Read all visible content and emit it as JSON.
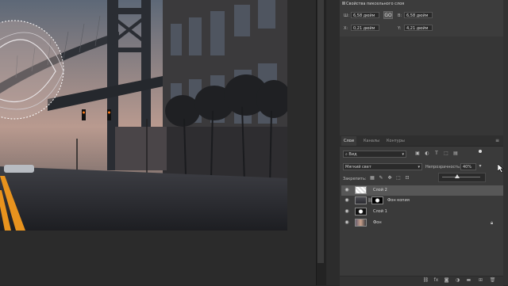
{
  "properties": {
    "title": "Свойства пиксельного слоя",
    "width_label": "Ш:",
    "width_value": "6,58 дюйм",
    "link_symbol": "GO",
    "height_label": "В:",
    "height_value": "6,58 дюйм",
    "x_label": "X:",
    "x_value": "0,21 дюйм",
    "y_label": "Y:",
    "y_value": "4,21 дюйм"
  },
  "layers_panel": {
    "tabs": [
      {
        "label": "Слои",
        "active": true
      },
      {
        "label": "Каналы",
        "active": false
      },
      {
        "label": "Контуры",
        "active": false
      }
    ],
    "menu_icon": "≡",
    "filter_label": "Вид",
    "blend_mode": "Мягкий свет",
    "opacity_label": "Непрозрачность:",
    "opacity_value": "40%",
    "lock_label": "Закрепить:",
    "fill_label": "",
    "layers": [
      {
        "name": "Слой 2",
        "visible": true,
        "selected": true
      },
      {
        "name": "Фон копия",
        "visible": true,
        "selected": false
      },
      {
        "name": "Слой 1",
        "visible": true,
        "selected": false
      },
      {
        "name": "Фон",
        "visible": true,
        "selected": false,
        "locked": true
      }
    ]
  },
  "icons": {
    "search": "search-icon",
    "filter_image": "image-filter-icon",
    "filter_adjust": "adjustment-filter-icon",
    "filter_text": "T",
    "filter_shape": "shape-filter-icon",
    "filter_smart": "smart-object-filter-icon",
    "lock_pixels": "lock-transparent-icon",
    "lock_paint": "brush-icon",
    "lock_move": "move-icon",
    "lock_artboard": "artboard-icon",
    "lock_all": "lock-icon",
    "link_layers": "link-icon",
    "fx": "fx",
    "mask": "mask-icon",
    "adjustment": "adjustment-icon",
    "group": "folder-icon",
    "new_layer": "new-layer-icon",
    "delete": "trash-icon"
  },
  "colors": {
    "panel_bg": "#323232",
    "selected_row": "#575757",
    "road_line": "#e8931e"
  }
}
